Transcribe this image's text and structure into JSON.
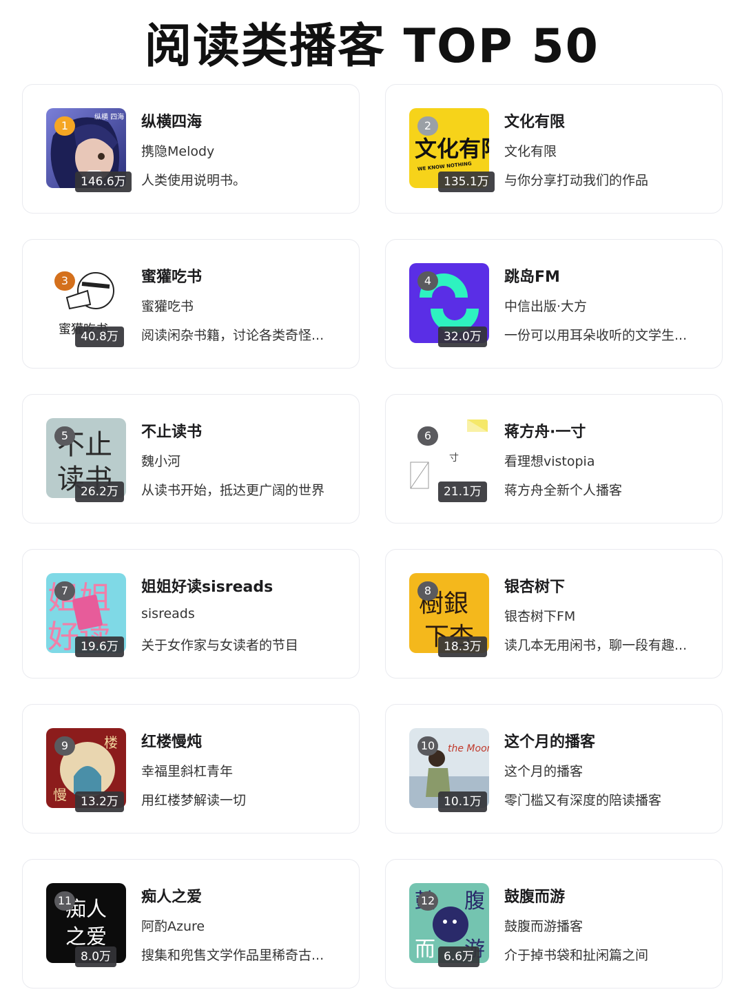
{
  "page_title": "阅读类播客 TOP 50",
  "podcasts": [
    {
      "rank": "1",
      "name": "纵横四海",
      "author": "携隐Melody",
      "desc": "人类使用说明书。",
      "plays": "146.6万",
      "badge_color": "#f5a623",
      "cover": "portrait-illustration",
      "cover_text": "纵横 四海"
    },
    {
      "rank": "2",
      "name": "文化有限",
      "author": "文化有限",
      "desc": "与你分享打动我们的作品",
      "plays": "135.1万",
      "badge_color": "#9aa0a6",
      "cover": "yellow-logo",
      "cover_text": "文化有限",
      "cover_subtext": "WE KNOW NOTHING"
    },
    {
      "rank": "3",
      "name": "蜜獾吃书",
      "author": "蜜獾吃书",
      "desc": "阅读闲杂书籍，讨论各类奇怪...",
      "plays": "40.8万",
      "badge_color": "#d4701c",
      "cover": "honey-badger-sketch",
      "cover_text": "蜜獾吃书"
    },
    {
      "rank": "4",
      "name": "跳岛FM",
      "author": "中信出版·大方",
      "desc": "一份可以用耳朵收听的文学生...",
      "plays": "32.0万",
      "badge_color": "#5a5a5e",
      "cover": "purple-logo"
    },
    {
      "rank": "5",
      "name": "不止读书",
      "author": "魏小河",
      "desc": "从读书开始，抵达更广阔的世界",
      "plays": "26.2万",
      "badge_color": "#5a5a5e",
      "cover": "calligraphy-grey",
      "cover_text": "不止读书"
    },
    {
      "rank": "6",
      "name": "蒋方舟·一寸",
      "author": "看理想vistopia",
      "desc": "蒋方舟全新个人播客",
      "plays": "21.1万",
      "badge_color": "#5a5a5e",
      "cover": "minimal-white",
      "cover_text": "寸"
    },
    {
      "rank": "7",
      "name": "姐姐好读sisreads",
      "author": "sisreads",
      "desc": "关于女作家与女读者的节目",
      "plays": "19.6万",
      "badge_color": "#5a5a5e",
      "cover": "pink-cyan",
      "cover_text": "姐姐好读"
    },
    {
      "rank": "8",
      "name": "银杏树下",
      "author": "银杏树下FM",
      "desc": "读几本无用闲书，聊一段有趣...",
      "plays": "18.3万",
      "badge_color": "#5a5a5e",
      "cover": "yellow-calligraphy",
      "cover_text": "樹銀下杏"
    },
    {
      "rank": "9",
      "name": "红楼慢炖",
      "author": "幸福里斜杠青年",
      "desc": "用红楼梦解读一切",
      "plays": "13.2万",
      "badge_color": "#5a5a5e",
      "cover": "red-painting",
      "cover_text": "红楼慢炖"
    },
    {
      "rank": "10",
      "name": "这个月的播客",
      "author": "这个月的播客",
      "desc": "零门槛又有深度的陪读播客",
      "plays": "10.1万",
      "badge_color": "#5a5a5e",
      "cover": "photo-woman",
      "cover_text": "the Moon"
    },
    {
      "rank": "11",
      "name": "痴人之爱",
      "author": "阿酌Azure",
      "desc": "搜集和兜售文学作品里稀奇古...",
      "plays": "8.0万",
      "badge_color": "#5a5a5e",
      "cover": "black-calligraphy",
      "cover_text": "痴人之爱"
    },
    {
      "rank": "12",
      "name": "鼓腹而游",
      "author": "鼓腹而游播客",
      "desc": "介于掉书袋和扯闲篇之间",
      "plays": "6.6万",
      "badge_color": "#5a5a5e",
      "cover": "teal-character",
      "cover_text": "鼓腹而游"
    }
  ]
}
